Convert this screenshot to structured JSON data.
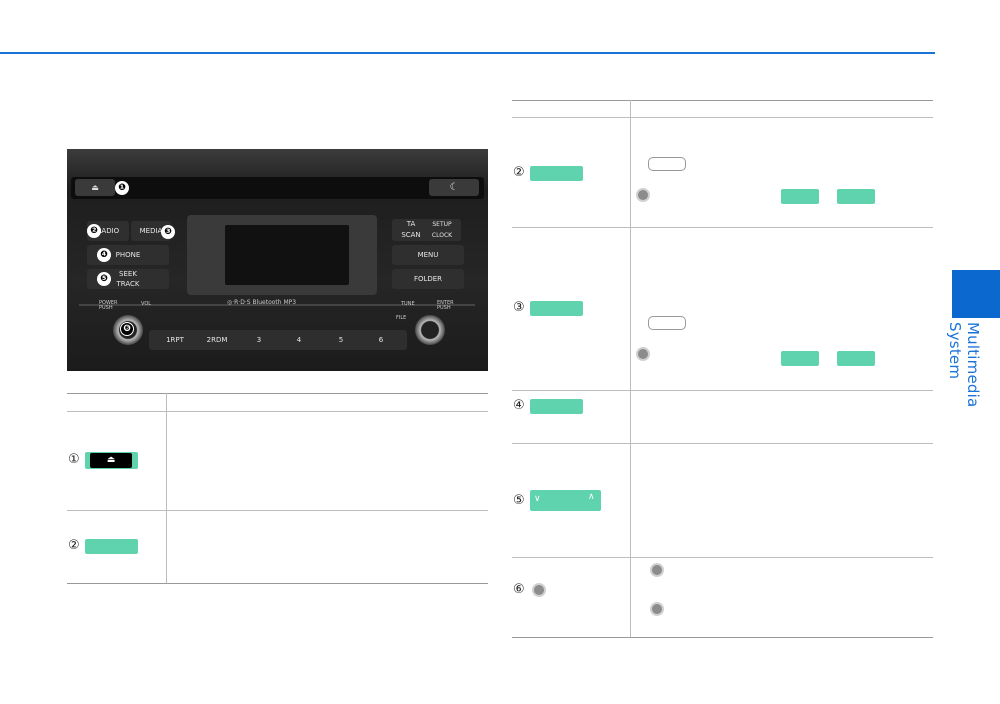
{
  "side_tab": {
    "label": "Multimedia System"
  },
  "photo": {
    "callouts": [
      "❶",
      "❷",
      "❸",
      "❹",
      "❺",
      "❻"
    ],
    "buttons": {
      "eject": "⏏",
      "moon": "☾",
      "radio": "RADIO",
      "media": "MEDIA",
      "phone": "PHONE",
      "seek_track": "SEEK\nTRACK",
      "ta_scan": "TA\nSCAN",
      "setup_clock": "SETUP\nCLOCK",
      "menu": "MENU",
      "folder": "FOLDER"
    },
    "labels": {
      "power": "POWER\nPUSH",
      "vol": "VOL",
      "tune": "TUNE",
      "enter": "ENTER\nPUSH",
      "file": "FILE",
      "logos": "◎·R·D·S   Bluetooth   MP3"
    },
    "presets": [
      "1RPT",
      "2RDM",
      "3",
      "4",
      "5",
      "6"
    ]
  },
  "left_table": {
    "rows": [
      {
        "num": "①",
        "icon": "⏏"
      },
      {
        "num": "②"
      }
    ]
  },
  "right_table": {
    "rows": [
      {
        "num": "②"
      },
      {
        "num": "③"
      },
      {
        "num": "④"
      },
      {
        "num": "⑤",
        "chev_left": "∨",
        "chev_right": "∧"
      },
      {
        "num": "⑥"
      }
    ]
  },
  "colors": {
    "accent": "#1a73d9",
    "tab": "#0a68cf",
    "button_green": "#5fd3ae"
  }
}
